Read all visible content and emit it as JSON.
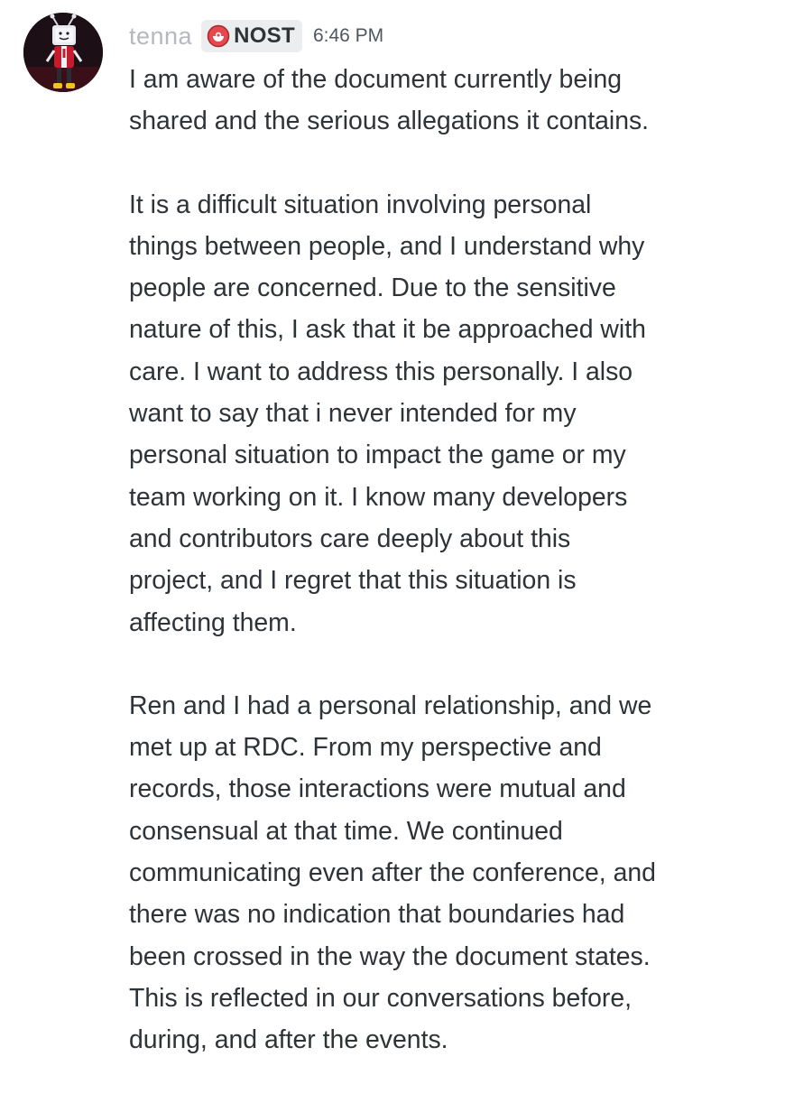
{
  "message": {
    "avatar_icon": "avatar-image",
    "username": "tenna",
    "tag": {
      "icon": "tag-icon",
      "label": "NOST"
    },
    "timestamp": "6:46 PM",
    "paragraphs": [
      {
        "lines": [
          "I am aware of the document currently being",
          "shared and the serious allegations it contains."
        ]
      },
      {
        "lines": [
          "It is a difficult situation involving personal",
          "things between people, and I understand why",
          "people are concerned. Due to the sensitive",
          "nature of this, I ask that it be approached with",
          "care. I want to address this personally. I also",
          "want to say that i never intended for my",
          "personal situation to impact the game or my",
          "team working on it. I know many developers",
          "and contributors care deeply about this",
          "project, and I regret that this situation is",
          "affecting them."
        ]
      },
      {
        "lines": [
          "Ren and I had a personal relationship, and we",
          "met up at RDC. From my perspective and",
          "records, those interactions were mutual and",
          "consensual at that time. We continued",
          "communicating even after the conference, and",
          "there was no indication that boundaries had",
          "been crossed in the way the document states.",
          "This is reflected in our conversations before,",
          "during, and after the events."
        ]
      }
    ]
  }
}
